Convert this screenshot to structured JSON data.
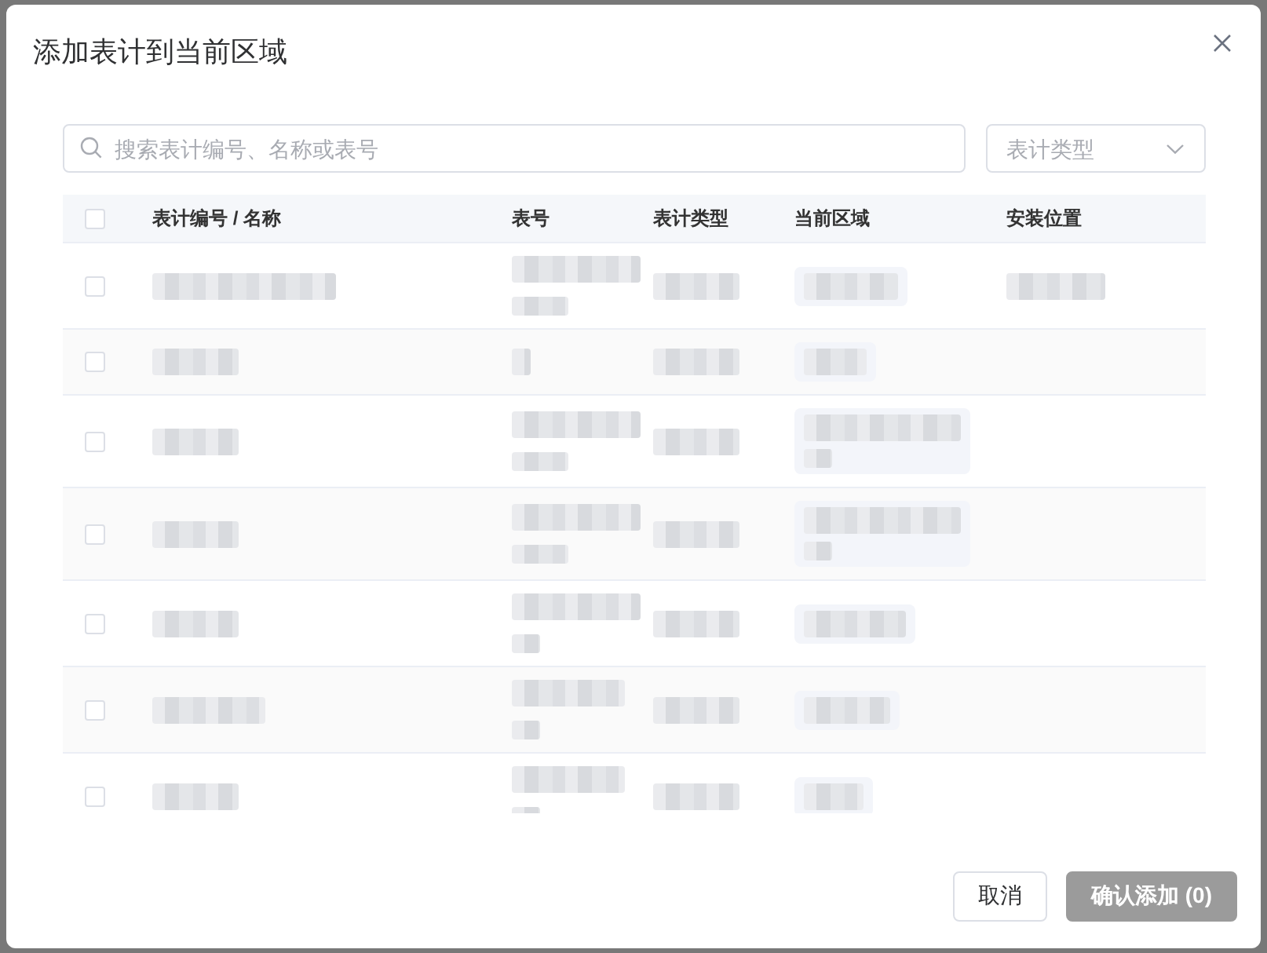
{
  "dialog": {
    "title": "添加表计到当前区域"
  },
  "search": {
    "placeholder": "搜索表计编号、名称或表号"
  },
  "type_filter": {
    "placeholder": "表计类型"
  },
  "table": {
    "select_all": {
      "checked": false
    },
    "columns": [
      {
        "label": "表计编号 / 名称",
        "kind": "text"
      },
      {
        "label": "表号",
        "kind": "text"
      },
      {
        "label": "表计类型",
        "kind": "text"
      },
      {
        "label": "当前区域",
        "kind": "tag"
      },
      {
        "label": "安装位置",
        "kind": "text"
      }
    ],
    "rows": [
      {
        "checked": false,
        "cells": [
          {
            "kind": "redacted"
          },
          {
            "kind": "redacted_two_line"
          },
          {
            "kind": "redacted"
          },
          {
            "kind": "redacted"
          },
          {
            "kind": "redacted"
          }
        ]
      },
      {
        "checked": false,
        "cells": [
          {
            "kind": "redacted"
          },
          {
            "kind": "redacted"
          },
          {
            "kind": "redacted"
          },
          {
            "kind": "redacted"
          }
        ]
      },
      {
        "checked": false,
        "cells": [
          {
            "kind": "redacted"
          },
          {
            "kind": "redacted_two_line"
          },
          {
            "kind": "redacted"
          },
          {
            "kind": "redacted_two_line"
          }
        ]
      },
      {
        "checked": false,
        "cells": [
          {
            "kind": "redacted"
          },
          {
            "kind": "redacted_two_line"
          },
          {
            "kind": "redacted"
          },
          {
            "kind": "redacted_two_line"
          }
        ]
      },
      {
        "checked": false,
        "cells": [
          {
            "kind": "redacted"
          },
          {
            "kind": "redacted_two_line"
          },
          {
            "kind": "redacted"
          },
          {
            "kind": "redacted"
          }
        ]
      },
      {
        "checked": false,
        "cells": [
          {
            "kind": "redacted"
          },
          {
            "kind": "redacted_two_line"
          },
          {
            "kind": "redacted"
          },
          {
            "kind": "redacted"
          }
        ]
      },
      {
        "checked": false,
        "cells": [
          {
            "kind": "redacted"
          },
          {
            "kind": "redacted_two_line"
          },
          {
            "kind": "redacted"
          },
          {
            "kind": "redacted"
          }
        ]
      }
    ]
  },
  "buttons": [
    {
      "label": "取消",
      "kind": "secondary",
      "disabled": false
    },
    {
      "label": "确认添加 (0)",
      "kind": "primary",
      "disabled": true
    }
  ]
}
